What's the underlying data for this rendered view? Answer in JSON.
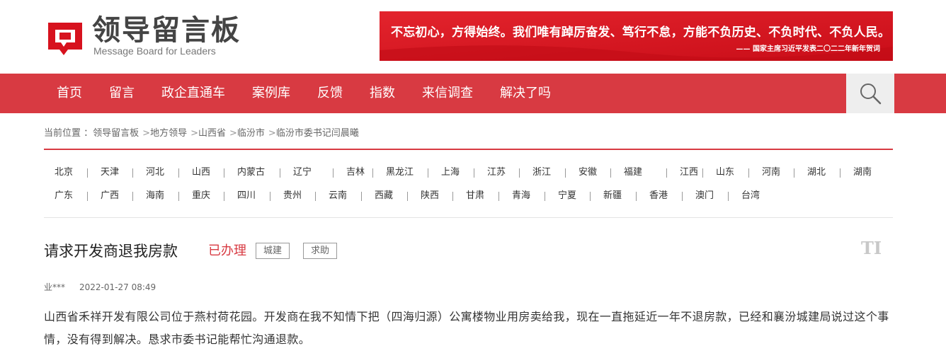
{
  "header": {
    "logo_cn": "领导留言板",
    "logo_en": "Message Board for Leaders",
    "banner_text": "不忘初心，方得始终。我们唯有踔厉奋发、笃行不怠，方能不负历史、不负时代、不负人民。",
    "banner_source": "—— 国家主席习近平发表二〇二二年新年贺词"
  },
  "nav": {
    "items": [
      "首页",
      "留言",
      "政企直通车",
      "案例库",
      "反馈",
      "指数",
      "来信调查",
      "解决了吗"
    ],
    "search_icon": "search-icon"
  },
  "breadcrumb": {
    "prefix": "当前位置 ：",
    "items": [
      "领导留言板",
      "地方领导",
      "山西省",
      "临汾市",
      "临汾市委书记闫晨曦"
    ],
    "separator": ">"
  },
  "provinces": {
    "row1": [
      "北京",
      "天津",
      "河北",
      "山西",
      "内蒙古",
      "辽宁",
      "吉林",
      "黑龙江",
      "上海",
      "江苏",
      "浙江",
      "安徽",
      "福建",
      "江西",
      "山东",
      "河南",
      "湖北",
      "湖南"
    ],
    "row2": [
      "广东",
      "广西",
      "海南",
      "重庆",
      "四川",
      "贵州",
      "云南",
      "西藏",
      "陕西",
      "甘肃",
      "青海",
      "宁夏",
      "新疆",
      "香港",
      "澳门",
      "台湾"
    ]
  },
  "message": {
    "title": "请求开发商退我房款",
    "status": "已办理",
    "tags": [
      "城建",
      "求助"
    ],
    "font_toggle": "TI",
    "author": "业***",
    "date": "2022-01-27 08:49",
    "body": "山西省禾祥开发有限公司位于燕村荷花园。开发商在我不知情下把（四海归源）公寓楼物业用房卖给我，现在一直拖延近一年不退房款，已经和襄汾城建局说过这个事情，没有得到解决。恳求市委书记能帮忙沟通退款。"
  },
  "colors": {
    "brand_red": "#d83a42",
    "banner_red": "#d7121e",
    "search_bg": "#eeeeee"
  }
}
